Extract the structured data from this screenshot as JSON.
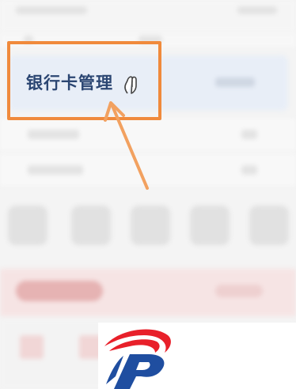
{
  "screen": {
    "highlighted_item_label": "银行卡管理"
  },
  "icons": {
    "cursor": "hand-pointer-icon",
    "arrow": "arrow-icon",
    "logo": "brand-logo"
  },
  "colors": {
    "callout_border": "#f08a3c",
    "highlight_text": "#2b4672",
    "logo_red": "#e8202a",
    "logo_blue": "#1f4ea0"
  }
}
